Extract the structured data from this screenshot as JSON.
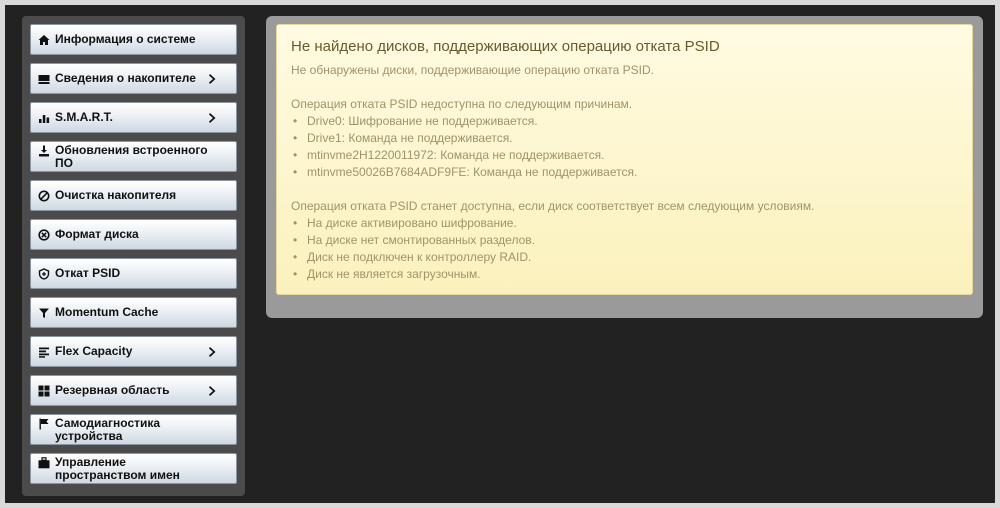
{
  "sidebar": {
    "items": [
      {
        "label": "Информация о системе",
        "icon": "home-icon",
        "chevron": false
      },
      {
        "label": "Сведения о накопителе",
        "icon": "drive-icon",
        "chevron": true
      },
      {
        "label": "S.M.A.R.T.",
        "icon": "bar-chart-icon",
        "chevron": true
      },
      {
        "label": "Обновления встроенного ПО",
        "icon": "download-icon",
        "chevron": false
      },
      {
        "label": "Очистка накопителя",
        "icon": "prohibit-icon",
        "chevron": false
      },
      {
        "label": "Формат диска",
        "icon": "gear-icon",
        "chevron": false
      },
      {
        "label": "Откат PSID",
        "icon": "psid-revert-icon",
        "chevron": false
      },
      {
        "label": "Momentum Cache",
        "icon": "funnel-icon",
        "chevron": false
      },
      {
        "label": "Flex Capacity",
        "icon": "list-icon",
        "chevron": true
      },
      {
        "label": "Резервная область",
        "icon": "grid-icon",
        "chevron": true
      },
      {
        "label": "Самодиагностика устройства",
        "icon": "flag-icon",
        "chevron": false
      },
      {
        "label": "Управление пространством имен",
        "icon": "briefcase-icon",
        "chevron": false
      }
    ]
  },
  "alert": {
    "title": "Не найдено дисков, поддерживающих операцию отката PSID",
    "subtitle": "Не обнаружены диски, поддерживающие операцию отката PSID.",
    "reasons_intro": "Операция отката PSID недоступна по следующим причинам.",
    "reasons": [
      "Drive0: Шифрование не поддерживается.",
      "Drive1: Команда не поддерживается.",
      "mtinvme2H1220011972: Команда не поддерживается.",
      "mtinvme50026B7684ADF9FE: Команда не поддерживается."
    ],
    "conditions_intro": "Операция отката PSID станет доступна, если диск соответствует всем следующим условиям.",
    "conditions": [
      "На диске активировано шифрование.",
      "На диске нет смонтированных разделов.",
      "Диск не подключен к контроллеру RAID.",
      "Диск не является загрузочным."
    ]
  },
  "colors": {
    "background": "#222222",
    "sidebar": "#4b4b4b",
    "alert_bg": "#fdf6cf",
    "alert_title": "#6a5a2c",
    "alert_text": "#a0936a"
  }
}
